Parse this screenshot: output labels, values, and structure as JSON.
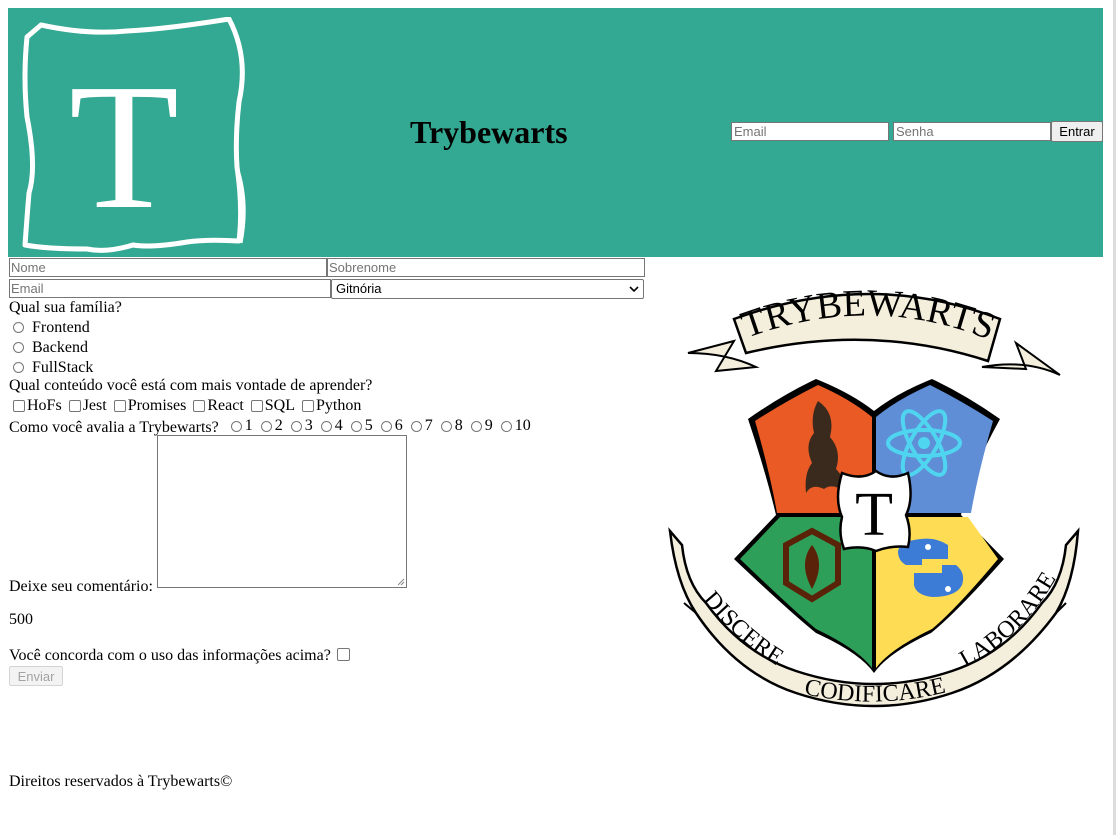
{
  "header": {
    "title": "Trybewarts",
    "logo_letter": "T",
    "login": {
      "email_placeholder": "Email",
      "password_placeholder": "Senha",
      "submit_label": "Entrar"
    }
  },
  "form": {
    "first_name_placeholder": "Nome",
    "last_name_placeholder": "Sobrenome",
    "email_placeholder": "Email",
    "house_selected": "Gitnória",
    "family": {
      "label": "Qual sua família?",
      "options": [
        "Frontend",
        "Backend",
        "FullStack"
      ]
    },
    "content": {
      "label": "Qual conteúdo você está com mais vontade de aprender?",
      "options": [
        "HoFs",
        "Jest",
        "Promises",
        "React",
        "SQL",
        "Python"
      ]
    },
    "rating": {
      "label": "Como você avalia a Trybewarts?",
      "options": [
        "1",
        "2",
        "3",
        "4",
        "5",
        "6",
        "7",
        "8",
        "9",
        "10"
      ]
    },
    "comment_label": "Deixe seu comentário:",
    "char_counter": "500",
    "agreement_label": "Você concorda com o uso das informações acima?",
    "submit_label": "Enviar"
  },
  "crest": {
    "banner_top": "TRYBEWARTS",
    "center_letter": "T",
    "ribbon_left": "DISCERE",
    "ribbon_bottom": "CODIFICARE",
    "ribbon_right": "LABORARE"
  },
  "footer": {
    "copyright": "Direitos reservados à Trybewarts©"
  },
  "colors": {
    "header_bg": "#33a892",
    "crest_orange": "#e95a24",
    "crest_blue": "#5f8ed6",
    "crest_green": "#2e9f58",
    "crest_yellow": "#fedd55",
    "ribbon": "#f4eedd"
  }
}
